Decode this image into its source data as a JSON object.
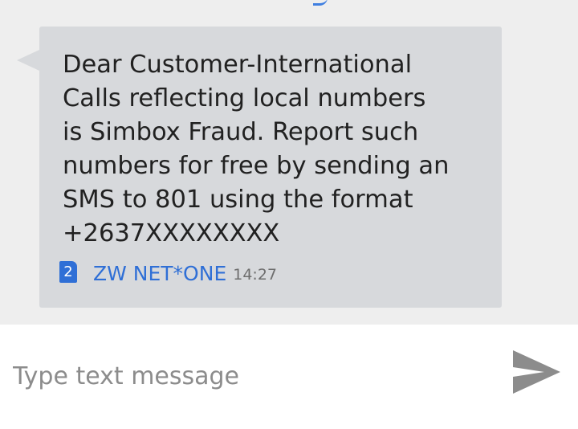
{
  "message": {
    "body": "Dear Customer-International\nCalls reflecting local numbers\nis Simbox Fraud. Report such\nnumbers for free by sending an\nSMS to 801 using the format\n+2637XXXXXXXX",
    "sim_slot": "2",
    "sender": "ZW NET*ONE",
    "time": "14:27"
  },
  "composer": {
    "placeholder": "Type text message",
    "value": ""
  },
  "icons": {
    "sim": "sim-card-icon",
    "send": "send-icon"
  },
  "colors": {
    "thread_background": "#eeeeee",
    "bubble_background": "#d7d9dc",
    "accent": "#2f6fd6",
    "send_icon": "#8c8c8c"
  }
}
